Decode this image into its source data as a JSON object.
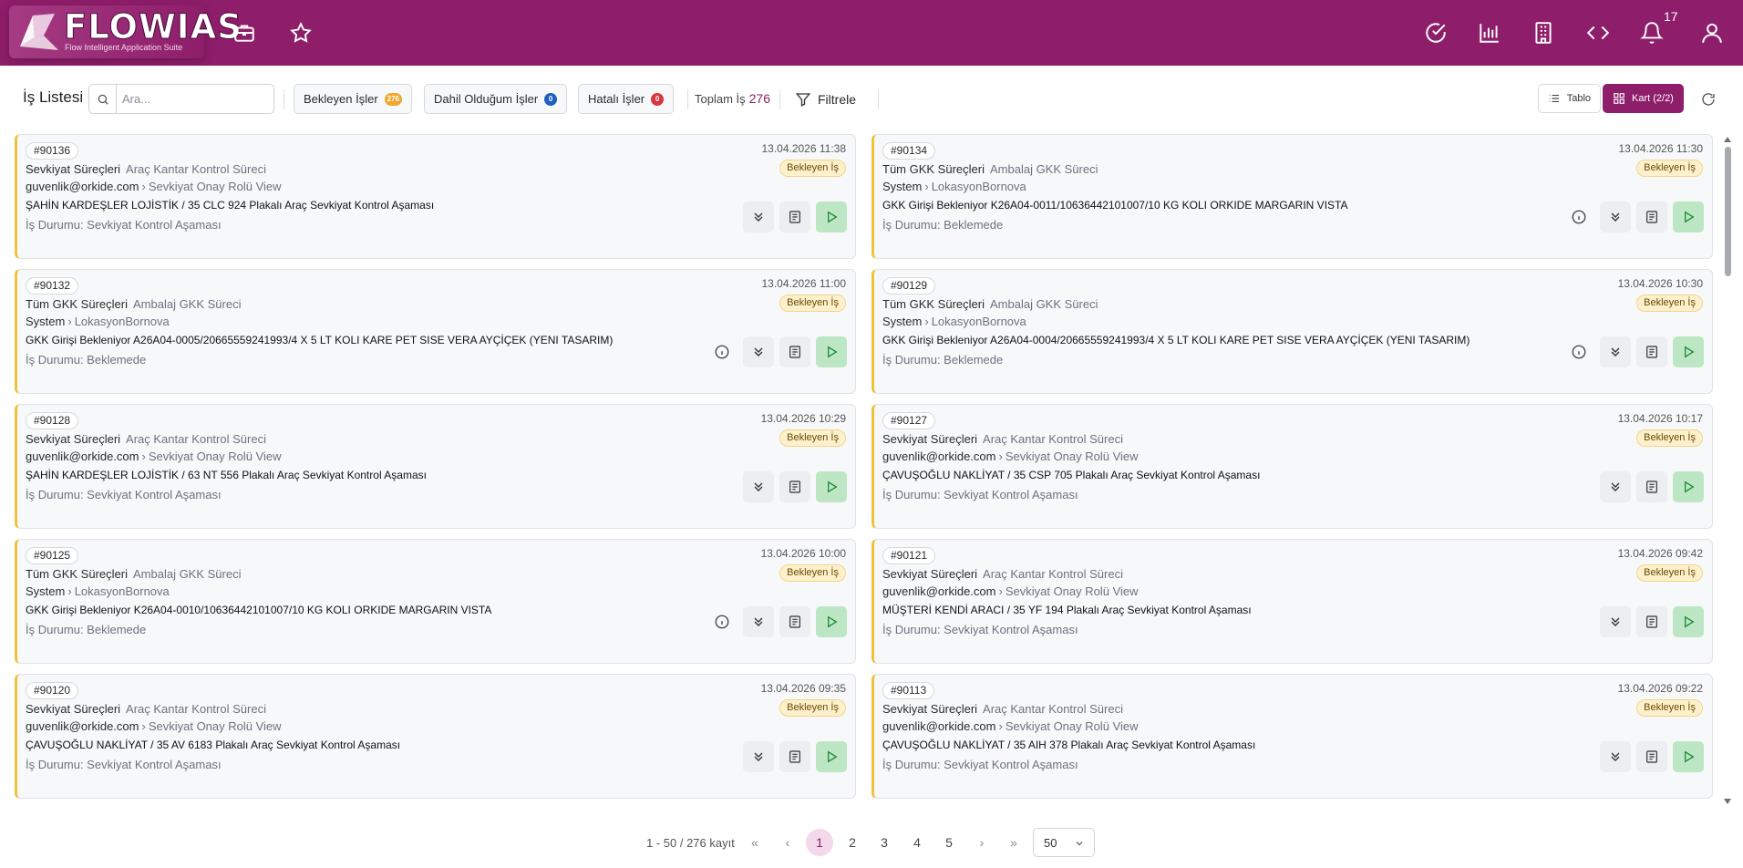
{
  "app": {
    "logo_text": "FLOWIAS",
    "logo_subtitle": "Flow Intelligent Application Suite",
    "notification_count": "17",
    "brand_color": "#8e1d6a"
  },
  "toolbar": {
    "title": "İş Listesi",
    "search_placeholder": "Ara...",
    "pending_label": "Bekleyen İşler",
    "pending_count": "276",
    "included_label": "Dahil Olduğum İşler",
    "included_count": "0",
    "error_label": "Hatalı İşler",
    "error_count": "0",
    "total_label": "Toplam İş",
    "total_count": "276",
    "filter_label": "Filtrele",
    "table_view_label": "Tablo",
    "card_view_label": "Kart (2/2)"
  },
  "cards": [
    {
      "id": "#90136",
      "date": "13.04.2026 11:38",
      "badge": "Bekleyen İş",
      "category": "Sevkiyat Süreçleri",
      "process": "Araç Kantar Kontrol Süreci",
      "user": "guvenlik@orkide.com",
      "role": "Sevkiyat Onay Rolü View",
      "description": "ŞAHİN KARDEŞLER LOJİSTİK / 35 CLC 924 Plakalı Araç Sevkiyat Kontrol Aşaması",
      "status": "İş Durumu: Sevkiyat Kontrol Aşaması",
      "has_info": false
    },
    {
      "id": "#90134",
      "date": "13.04.2026 11:30",
      "badge": "Bekleyen İş",
      "category": "Tüm GKK Süreçleri",
      "process": "Ambalaj GKK Süreci",
      "user": "System",
      "role": "LokasyonBornova",
      "description": "GKK Girişi Bekleniyor K26A04-0011/10636442101007/10 KG KOLI ORKIDE MARGARIN VISTA",
      "status": "İş Durumu: Beklemede",
      "has_info": true
    },
    {
      "id": "#90132",
      "date": "13.04.2026 11:00",
      "badge": "Bekleyen İş",
      "category": "Tüm GKK Süreçleri",
      "process": "Ambalaj GKK Süreci",
      "user": "System",
      "role": "LokasyonBornova",
      "description": "GKK Girişi Bekleniyor A26A04-0005/20665559241993/4 X 5 LT KOLI KARE PET SISE VERA AYÇİÇEK (YENI TASARIM)",
      "status": "İş Durumu: Beklemede",
      "has_info": true
    },
    {
      "id": "#90129",
      "date": "13.04.2026 10:30",
      "badge": "Bekleyen İş",
      "category": "Tüm GKK Süreçleri",
      "process": "Ambalaj GKK Süreci",
      "user": "System",
      "role": "LokasyonBornova",
      "description": "GKK Girişi Bekleniyor A26A04-0004/20665559241993/4 X 5 LT KOLI KARE PET SISE VERA AYÇİÇEK (YENI TASARIM)",
      "status": "İş Durumu: Beklemede",
      "has_info": true
    },
    {
      "id": "#90128",
      "date": "13.04.2026 10:29",
      "badge": "Bekleyen İş",
      "category": "Sevkiyat Süreçleri",
      "process": "Araç Kantar Kontrol Süreci",
      "user": "guvenlik@orkide.com",
      "role": "Sevkiyat Onay Rolü View",
      "description": "ŞAHİN KARDEŞLER LOJİSTİK / 63 NT 556 Plakalı Araç Sevkiyat Kontrol Aşaması",
      "status": "İş Durumu: Sevkiyat Kontrol Aşaması",
      "has_info": false
    },
    {
      "id": "#90127",
      "date": "13.04.2026 10:17",
      "badge": "Bekleyen İş",
      "category": "Sevkiyat Süreçleri",
      "process": "Araç Kantar Kontrol Süreci",
      "user": "guvenlik@orkide.com",
      "role": "Sevkiyat Onay Rolü View",
      "description": "ÇAVUŞOĞLU NAKLİYAT / 35 CSP 705 Plakalı Araç Sevkiyat Kontrol Aşaması",
      "status": "İş Durumu: Sevkiyat Kontrol Aşaması",
      "has_info": false
    },
    {
      "id": "#90125",
      "date": "13.04.2026 10:00",
      "badge": "Bekleyen İş",
      "category": "Tüm GKK Süreçleri",
      "process": "Ambalaj GKK Süreci",
      "user": "System",
      "role": "LokasyonBornova",
      "description": "GKK Girişi Bekleniyor K26A04-0010/10636442101007/10 KG KOLI ORKIDE MARGARIN VISTA",
      "status": "İş Durumu: Beklemede",
      "has_info": true
    },
    {
      "id": "#90121",
      "date": "13.04.2026 09:42",
      "badge": "Bekleyen İş",
      "category": "Sevkiyat Süreçleri",
      "process": "Araç Kantar Kontrol Süreci",
      "user": "guvenlik@orkide.com",
      "role": "Sevkiyat Onay Rolü View",
      "description": "MÜŞTERİ KENDİ ARACI / 35 YF 194 Plakalı Araç Sevkiyat Kontrol Aşaması",
      "status": "İş Durumu: Sevkiyat Kontrol Aşaması",
      "has_info": false
    },
    {
      "id": "#90120",
      "date": "13.04.2026 09:35",
      "badge": "Bekleyen İş",
      "category": "Sevkiyat Süreçleri",
      "process": "Araç Kantar Kontrol Süreci",
      "user": "guvenlik@orkide.com",
      "role": "Sevkiyat Onay Rolü View",
      "description": "ÇAVUŞOĞLU NAKLİYAT / 35 AV 6183 Plakalı Araç Sevkiyat Kontrol Aşaması",
      "status": "İş Durumu: Sevkiyat Kontrol Aşaması",
      "has_info": false
    },
    {
      "id": "#90113",
      "date": "13.04.2026 09:22",
      "badge": "Bekleyen İş",
      "category": "Sevkiyat Süreçleri",
      "process": "Araç Kantar Kontrol Süreci",
      "user": "guvenlik@orkide.com",
      "role": "Sevkiyat Onay Rolü View",
      "description": "ÇAVUŞOĞLU NAKLİYAT / 35 AIH 378 Plakalı Araç Sevkiyat Kontrol Aşaması",
      "status": "İş Durumu: Sevkiyat Kontrol Aşaması",
      "has_info": false
    }
  ],
  "pagination": {
    "info": "1 - 50 / 276 kayıt",
    "pages": [
      "1",
      "2",
      "3",
      "4",
      "5"
    ],
    "active_page": "1",
    "page_size": "50"
  }
}
